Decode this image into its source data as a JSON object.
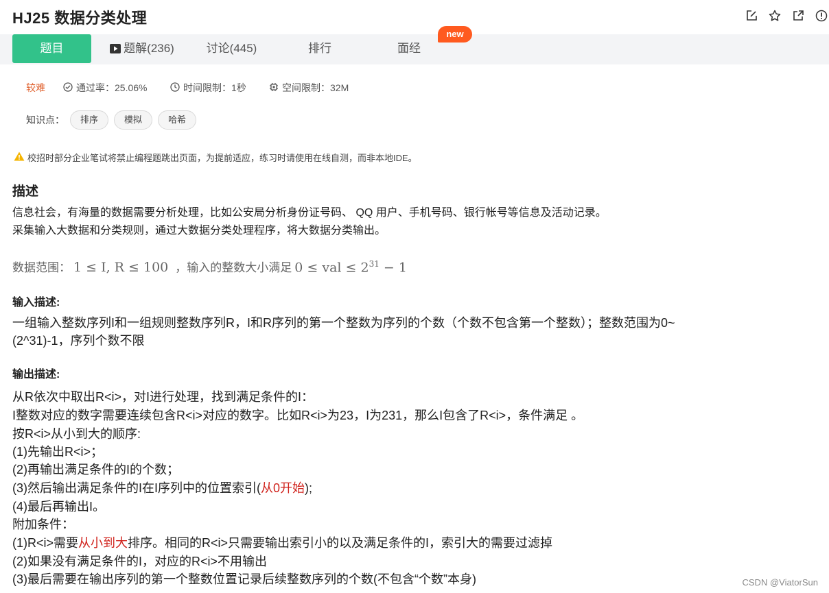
{
  "problem": {
    "title": "HJ25  数据分类处理"
  },
  "tabs": [
    {
      "label": "题目"
    },
    {
      "label": "题解(236)"
    },
    {
      "label": "讨论(445)"
    },
    {
      "label": "排行"
    },
    {
      "label": "面经"
    }
  ],
  "new_badge": "new",
  "meta": {
    "difficulty": "较难",
    "pass_rate": "通过率：25.06%",
    "time_limit": "时间限制：1秒",
    "space_limit": "空间限制：32M"
  },
  "knowledge": {
    "label": "知识点：",
    "tags": [
      "排序",
      "模拟",
      "哈希"
    ]
  },
  "warning": "校招时部分企业笔试将禁止编程题跳出页面，为提前适应，练习时请使用在线自测，而非本地IDE。",
  "description": {
    "heading": "描述",
    "lines": [
      "信息社会，有海量的数据需要分析处理，比如公安局分析身份证号码、 QQ 用户、手机号码、银行帐号等信息及活动记录。",
      "采集输入大数据和分类规则，通过大数据分类处理程序，将大数据分类输出。"
    ],
    "range_label": "数据范围：",
    "range_math_1": "1 ≤ I, R ≤ 100",
    "range_mid": "，输入的整数大小满足",
    "range_math_2": "0 ≤ val ≤ 2",
    "range_exp": "31",
    "range_tail": " − 1"
  },
  "input": {
    "heading": "输入描述:",
    "lines": [
      "一组输入整数序列I和一组规则整数序列R，I和R序列的第一个整数为序列的个数（个数不包含第一个整数）；整数范围为0~",
      "(2^31)-1，序列个数不限"
    ]
  },
  "output": {
    "heading": "输出描述:",
    "line1": "从R依次中取出R<i>，对I进行处理，找到满足条件的I：",
    "line2": "I整数对应的数字需要连续包含R<i>对应的数字。比如R<i>为23，I为231，那么I包含了R<i>，条件满足 。",
    "line3": "按R<i>从小到大的顺序:",
    "line4": "(1)先输出R<i>；",
    "line5": "(2)再输出满足条件的I的个数；",
    "line6_a": "(3)然后输出满足条件的I在I序列中的位置索引(",
    "line6_red": "从0开始",
    "line6_b": ");",
    "line7": "(4)最后再输出I。",
    "line8": "附加条件：",
    "line9_a": "(1)R<i>需要",
    "line9_red": "从小到大",
    "line9_b": "排序。相同的R<i>只需要输出索引小的以及满足条件的I，索引大的需要过滤掉",
    "line10": "(2)如果没有满足条件的I，对应的R<i>不用输出",
    "line11": "(3)最后需要在输出序列的第一个整数位置记录后续整数序列的个数(不包含“个数”本身)"
  },
  "watermark": "CSDN @ViatorSun",
  "colors": {
    "accent": "#32c28a",
    "badge": "#ff5a1f",
    "difficulty": "#e0622f",
    "highlight": "#d0221c"
  }
}
